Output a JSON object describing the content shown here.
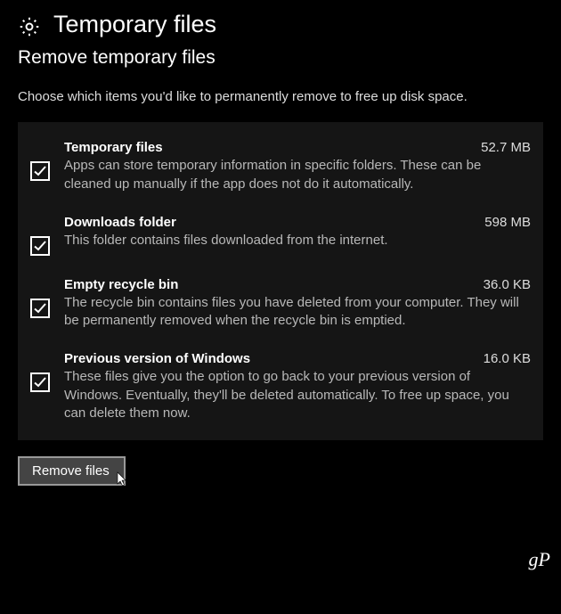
{
  "header": {
    "title": "Temporary files"
  },
  "subtitle": "Remove temporary files",
  "description": "Choose which items you'd like to permanently remove to free up disk space.",
  "items": [
    {
      "title": "Temporary files",
      "size": "52.7 MB",
      "desc": "Apps can store temporary information in specific folders. These can be cleaned up manually if the app does not do it automatically.",
      "checked": true
    },
    {
      "title": "Downloads folder",
      "size": "598 MB",
      "desc": "This folder contains files downloaded from the internet.",
      "checked": true
    },
    {
      "title": "Empty recycle bin",
      "size": "36.0 KB",
      "desc": "The recycle bin contains files you have deleted from your computer. They will be permanently removed when the recycle bin is emptied.",
      "checked": true
    },
    {
      "title": "Previous version of Windows",
      "size": "16.0 KB",
      "desc": "These files give you the option to go back to your previous version of Windows. Eventually, they'll be deleted automatically. To free up space, you can delete them now.",
      "checked": true
    }
  ],
  "actions": {
    "remove_label": "Remove files"
  },
  "watermark": "gP"
}
